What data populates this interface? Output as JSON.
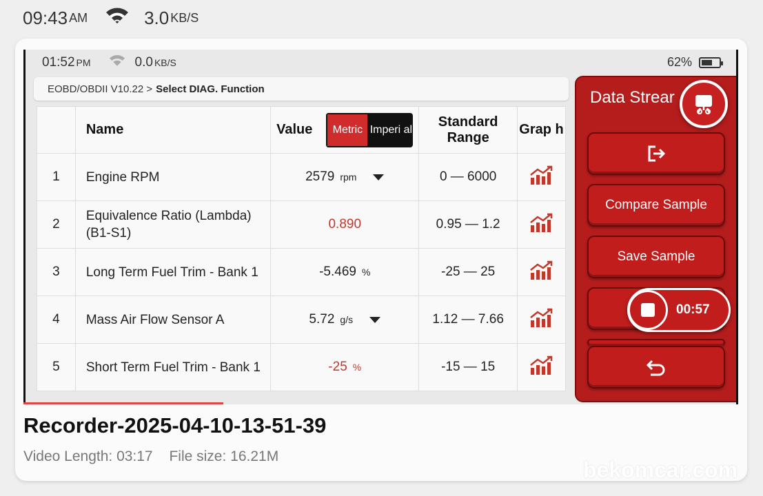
{
  "outer_status": {
    "time": "09:43",
    "ampm": "AM",
    "speed": "3.0",
    "speed_unit": "KB/S"
  },
  "inner_status": {
    "time": "01:52",
    "ampm": "PM",
    "speed": "0.0",
    "speed_unit": "KB/S",
    "battery": "62%"
  },
  "breadcrumb": {
    "path": "EOBD/OBDII V10.22 >",
    "current": "Select DIAG. Function"
  },
  "table": {
    "headers": {
      "name": "Name",
      "value": "Value",
      "standard_range": "Standard Range",
      "graph": "Grap h"
    },
    "unit_toggle": {
      "active": "Metric",
      "inactive": "Imperi al"
    },
    "rows": [
      {
        "index": "1",
        "name": "Engine RPM",
        "value": "2579",
        "unit": "rpm",
        "range": "0 — 6000",
        "alert": false,
        "dropdown": true
      },
      {
        "index": "2",
        "name": "Equivalence Ratio (Lambda) (B1-S1)",
        "value": "0.890",
        "unit": "",
        "range": "0.95 — 1.2",
        "alert": true,
        "dropdown": false
      },
      {
        "index": "3",
        "name": "Long Term Fuel Trim - Bank 1",
        "value": "-5.469",
        "unit": "%",
        "range": "-25 — 25",
        "alert": false,
        "dropdown": false
      },
      {
        "index": "4",
        "name": "Mass Air Flow Sensor A",
        "value": "5.72",
        "unit": "g/s",
        "range": "1.12 — 7.66",
        "alert": false,
        "dropdown": true
      },
      {
        "index": "5",
        "name": "Short Term Fuel Trim - Bank 1",
        "value": "-25",
        "unit": "%",
        "range": "-15 — 15",
        "alert": true,
        "dropdown": false
      }
    ]
  },
  "panel": {
    "title": "Data Strear",
    "buttons": {
      "compare": "Compare Sample",
      "save": "Save Sample"
    },
    "record_time": "00:57"
  },
  "recording": {
    "name": "Recorder-2025-04-10-13-51-39",
    "length": "Video Length: 03:17",
    "size": "File size: 16.21M"
  },
  "watermark": "bekomcar.com",
  "colors": {
    "accent_red": "#c21d1d",
    "alert_text": "#c0392b",
    "progress": "#e24545"
  },
  "icons": [
    "wifi-icon",
    "battery-icon",
    "graph-icon",
    "snapshot-icon",
    "exit-icon",
    "stop-icon",
    "back-icon",
    "dropdown-caret-icon"
  ]
}
